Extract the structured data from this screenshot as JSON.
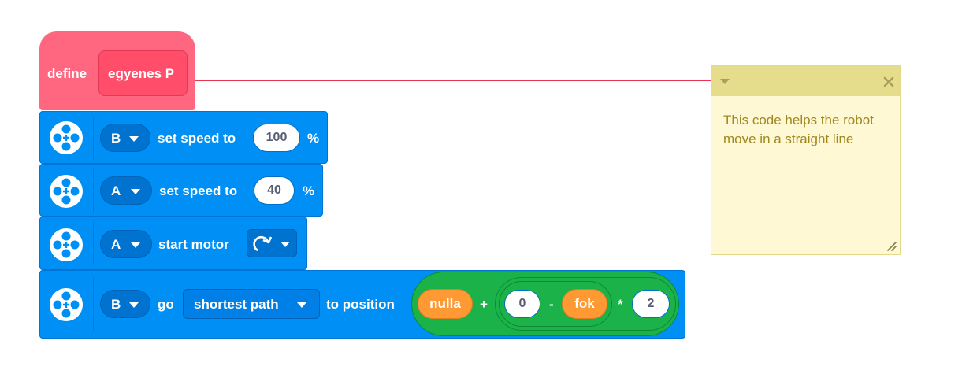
{
  "define_block": {
    "keyword": "define",
    "name": "egyenes P"
  },
  "blocks": [
    {
      "port": "B",
      "label": "set speed to",
      "value": "100",
      "unit": "%"
    },
    {
      "port": "A",
      "label": "set speed to",
      "value": "40",
      "unit": "%"
    },
    {
      "port": "A",
      "label": "start motor",
      "direction_icon": "clockwise-arrow-icon"
    },
    {
      "port": "B",
      "label": "go",
      "path_option": "shortest path",
      "label2": "to position"
    }
  ],
  "expression": {
    "var1": "nulla",
    "op_plus": "+",
    "num0": "0",
    "op_minus": "-",
    "var2": "fok",
    "op_times": "*",
    "num2": "2"
  },
  "comment": {
    "text": "This code helps the robot move in a straight line",
    "collapse_icon": "caret-down-icon",
    "close_icon": "close-icon",
    "resize_icon": "resize-icon"
  },
  "colors": {
    "define": "#ff6680",
    "motor": "#0090f5",
    "operator": "#1bb24a",
    "variable": "#ff9933",
    "comment_bg": "#fff8d4",
    "comment_bar": "#e5dc8c",
    "link_line": "#e8354f"
  }
}
